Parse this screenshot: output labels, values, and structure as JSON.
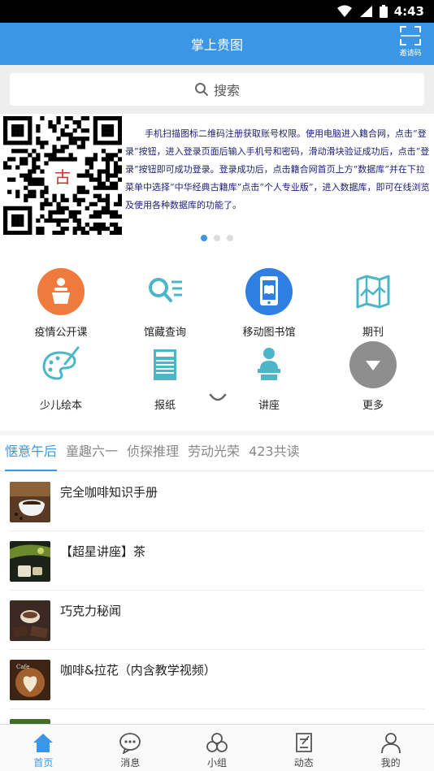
{
  "status": {
    "time": "4:43"
  },
  "header": {
    "title": "掌上贵图",
    "invite_label": "邀请码"
  },
  "search": {
    "label": "搜索"
  },
  "banner": {
    "text": "手机扫描图标二维码注册获取账号权限。使用电脑进入籍合网，点击“登录”按钮，进入登录页面后输入手机号和密码，滑动滑块验证成功后，点击“登录”按钮即可成功登录。登录成功后，点击籍合网首页上方“数据库”并在下拉菜单中选择“中华经典古籍库”点击“个人专业版”，进入数据库，即可在线浏览及使用各种数据库的功能了。",
    "qr_center_char": "古",
    "active_dot": 0
  },
  "grid": [
    {
      "label": "疫情公开课",
      "icon": "lecture-podium-icon"
    },
    {
      "label": "馆藏查询",
      "icon": "search-list-icon"
    },
    {
      "label": "移动图书馆",
      "icon": "mobile-library-icon"
    },
    {
      "label": "期刊",
      "icon": "journal-map-icon"
    },
    {
      "label": "少儿绘本",
      "icon": "palette-icon"
    },
    {
      "label": "报纸",
      "icon": "newspaper-icon"
    },
    {
      "label": "讲座",
      "icon": "speaker-icon"
    },
    {
      "label": "更多",
      "icon": "more-chevron-icon"
    }
  ],
  "tabs": [
    "惬意午后",
    "童趣六一",
    "侦探推理",
    "劳动光荣",
    "423共读"
  ],
  "list": [
    {
      "title": "完全咖啡知识手册"
    },
    {
      "title": "【超星讲座】茶"
    },
    {
      "title": "巧克力秘闻"
    },
    {
      "title": "咖啡&拉花（内含教学视频）"
    }
  ],
  "nav": [
    {
      "label": "首页",
      "icon": "home-icon"
    },
    {
      "label": "消息",
      "icon": "message-icon"
    },
    {
      "label": "小组",
      "icon": "group-icon"
    },
    {
      "label": "动态",
      "icon": "activity-icon"
    },
    {
      "label": "我的",
      "icon": "profile-icon"
    }
  ],
  "colors": {
    "primary": "#3c96e6",
    "orange": "#ef7a3c",
    "teal": "#4bb6c8",
    "gray_more": "#8e8e8e"
  }
}
